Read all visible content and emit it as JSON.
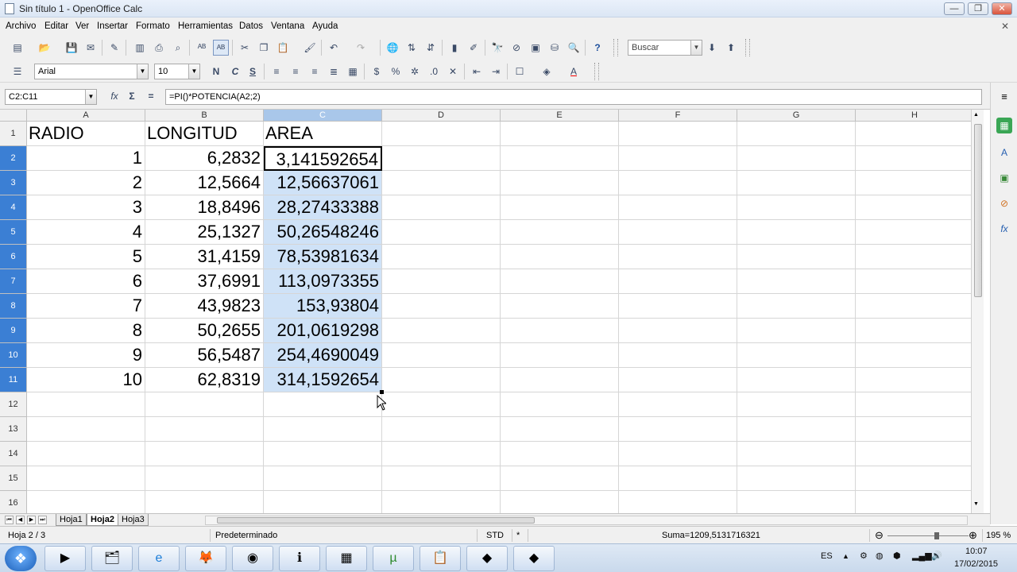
{
  "window": {
    "title": "Sin título 1 - OpenOffice Calc",
    "min": "—",
    "max": "❐",
    "close": "✕"
  },
  "menu": [
    "Archivo",
    "Editar",
    "Ver",
    "Insertar",
    "Formato",
    "Herramientas",
    "Datos",
    "Ventana",
    "Ayuda"
  ],
  "toolbar": {
    "search_placeholder": "Buscar",
    "font_name": "Arial",
    "font_size": "10",
    "bold": "N",
    "italic": "C",
    "underline": "S"
  },
  "formula_bar": {
    "name_box": "C2:C11",
    "formula": "=PI()*POTENCIA(A2;2)",
    "fx_icon": "fx",
    "sum_icon": "Σ",
    "equals_icon": "="
  },
  "sheet": {
    "columns": [
      "A",
      "B",
      "C",
      "D",
      "E",
      "F",
      "G",
      "H"
    ],
    "rows": [
      "1",
      "2",
      "3",
      "4",
      "5",
      "6",
      "7",
      "8",
      "9",
      "10",
      "11",
      "12",
      "13",
      "14",
      "15",
      "16"
    ],
    "header_row": [
      "RADIO",
      "LONGITUD",
      "AREA"
    ],
    "data": [
      [
        "1",
        "6,2832",
        "3,141592654"
      ],
      [
        "2",
        "12,5664",
        "12,56637061"
      ],
      [
        "3",
        "18,8496",
        "28,27433388"
      ],
      [
        "4",
        "25,1327",
        "50,26548246"
      ],
      [
        "5",
        "31,4159",
        "78,53981634"
      ],
      [
        "6",
        "37,6991",
        "113,0973355"
      ],
      [
        "7",
        "43,9823",
        "153,93804"
      ],
      [
        "8",
        "50,2655",
        "201,0619298"
      ],
      [
        "9",
        "56,5487",
        "254,4690049"
      ],
      [
        "10",
        "62,8319",
        "314,1592654"
      ]
    ]
  },
  "tabs": [
    "Hoja1",
    "Hoja2",
    "Hoja3"
  ],
  "active_tab": "Hoja2",
  "status": {
    "sheet_pos": "Hoja 2 / 3",
    "style": "Predeterminado",
    "mode": "STD",
    "modified": "*",
    "sum": "Suma=1209,5131716321",
    "zoom": "195 %"
  },
  "taskbar": {
    "lang": "ES",
    "time": "10:07",
    "date": "17/02/2015"
  },
  "colors": {
    "selection": "#cfe2f7",
    "selected_row_header": "#3b7fd4",
    "selected_col_header": "#a9c7ea"
  }
}
